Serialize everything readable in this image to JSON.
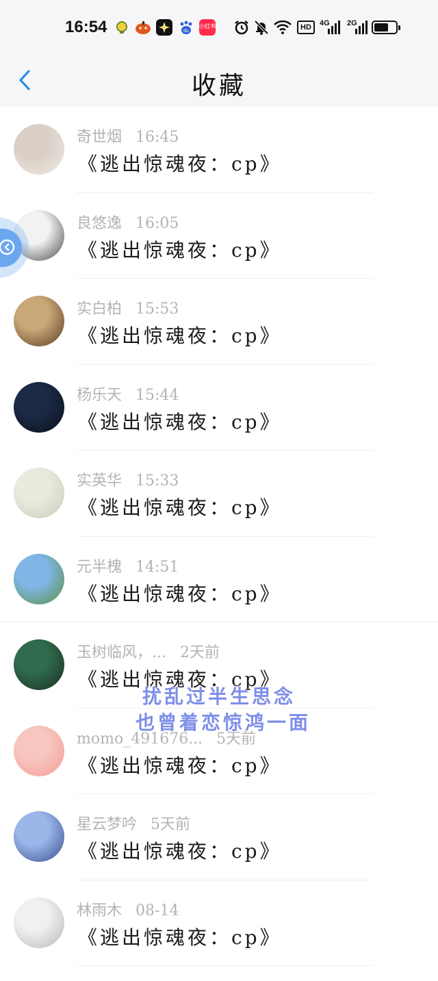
{
  "status_bar": {
    "time": "16:54",
    "app_icons": [
      "bee-icon",
      "pumpkin-icon",
      "star-icon",
      "baidu-icon",
      "xiaohongshu-icon"
    ],
    "xhs_label": "小红书",
    "du_label": "du",
    "hd_label": "HD",
    "net_4g": "4G",
    "net_2g": "2G",
    "battery_level": 0.7
  },
  "header": {
    "title": "收藏"
  },
  "list": [
    {
      "name": "奇世烟",
      "time": "16:45",
      "message": "《逃出惊魂夜：cp》",
      "avatar_colors": [
        "#d9cfc6",
        "#efe9e4"
      ]
    },
    {
      "name": "良悠逸",
      "time": "16:05",
      "message": "《逃出惊魂夜：cp》",
      "avatar_colors": [
        "#f2f2f2",
        "#4a4a4a"
      ]
    },
    {
      "name": "实白柏",
      "time": "15:53",
      "message": "《逃出惊魂夜：cp》",
      "avatar_colors": [
        "#c9a878",
        "#5b3a22"
      ]
    },
    {
      "name": "杨乐天",
      "time": "15:44",
      "message": "《逃出惊魂夜：cp》",
      "avatar_colors": [
        "#1b2a44",
        "#0a0f1c"
      ]
    },
    {
      "name": "实英华",
      "time": "15:33",
      "message": "《逃出惊魂夜：cp》",
      "avatar_colors": [
        "#e9ebdf",
        "#c9cbb8"
      ]
    },
    {
      "name": "元半槐",
      "time": "14:51",
      "message": "《逃出惊魂夜：cp》",
      "avatar_colors": [
        "#7fb6e6",
        "#5d8f3e"
      ]
    },
    {
      "name": "玉树临风，...",
      "time": "2天前",
      "message": "《逃出惊魂夜：cp》",
      "avatar_colors": [
        "#2f6b4c",
        "#1c2c24"
      ]
    },
    {
      "name": "momo_491676...",
      "time": "5天前",
      "message": "《逃出惊魂夜：cp》",
      "avatar_colors": [
        "#f7c6c0",
        "#f49d93"
      ]
    },
    {
      "name": "星云梦吟",
      "time": "5天前",
      "message": "《逃出惊魂夜：cp》",
      "avatar_colors": [
        "#9ab7ea",
        "#3b4f8c"
      ]
    },
    {
      "name": "林雨木",
      "time": "08-14",
      "message": "《逃出惊魂夜：cp》",
      "avatar_colors": [
        "#f0f0f0",
        "#b8b8b8"
      ]
    }
  ],
  "overlay_text": {
    "line1": "扰乱过半生思念",
    "line2": "也曾着恋惊鸿一面"
  },
  "floating_button": {
    "icon": "collapse-arrow-icon"
  }
}
